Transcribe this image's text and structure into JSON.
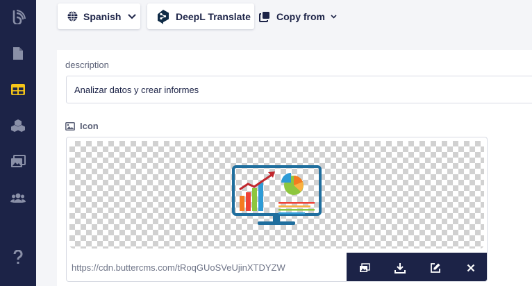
{
  "sidebar": {
    "items": [
      {
        "icon": "butter-logo-icon"
      },
      {
        "icon": "pages-icon"
      },
      {
        "icon": "collections-icon",
        "active": true
      },
      {
        "icon": "components-icon"
      },
      {
        "icon": "media-library-icon"
      },
      {
        "icon": "users-icon"
      },
      {
        "icon": "help-icon"
      }
    ],
    "active_color": "#f5c518"
  },
  "toolbar": {
    "language_label": "Spanish",
    "deepl_label": "DeepL Translate",
    "copy_label": "Copy from"
  },
  "fields": {
    "description": {
      "label": "description",
      "value": "Analizar datos y crear informes"
    },
    "icon": {
      "label": "Icon",
      "url": "https://cdn.buttercms.com/tRoqGUoSVeUjinXTDYZW"
    }
  },
  "media_actions": [
    {
      "icon": "media-library-icon"
    },
    {
      "icon": "download-icon"
    },
    {
      "icon": "edit-icon"
    },
    {
      "icon": "close-icon"
    }
  ],
  "colors": {
    "navy": "#1c2347",
    "accent": "#f5c518"
  }
}
